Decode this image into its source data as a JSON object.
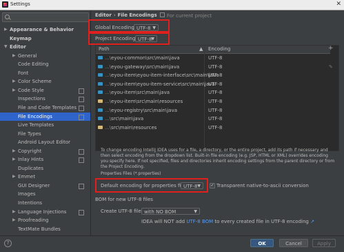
{
  "window": {
    "title": "Settings"
  },
  "sidebar": {
    "items": [
      {
        "label": "Appearance & Behavior",
        "arrow": "▶",
        "indent": 0,
        "bold": true
      },
      {
        "label": "Keymap",
        "arrow": "",
        "indent": 0,
        "bold": true
      },
      {
        "label": "Editor",
        "arrow": "▼",
        "indent": 0,
        "bold": true
      },
      {
        "label": "General",
        "arrow": "▶",
        "indent": 1
      },
      {
        "label": "Code Editing",
        "arrow": "",
        "indent": 1
      },
      {
        "label": "Font",
        "arrow": "",
        "indent": 1
      },
      {
        "label": "Color Scheme",
        "arrow": "▶",
        "indent": 1
      },
      {
        "label": "Code Style",
        "arrow": "▶",
        "indent": 1,
        "project": true
      },
      {
        "label": "Inspections",
        "arrow": "",
        "indent": 1,
        "project": true
      },
      {
        "label": "File and Code Templates",
        "arrow": "",
        "indent": 1,
        "project": true
      },
      {
        "label": "File Encodings",
        "arrow": "",
        "indent": 1,
        "project": true,
        "selected": true
      },
      {
        "label": "Live Templates",
        "arrow": "",
        "indent": 1
      },
      {
        "label": "File Types",
        "arrow": "",
        "indent": 1
      },
      {
        "label": "Android Layout Editor",
        "arrow": "",
        "indent": 1
      },
      {
        "label": "Copyright",
        "arrow": "▶",
        "indent": 1,
        "project": true
      },
      {
        "label": "Inlay Hints",
        "arrow": "▶",
        "indent": 1,
        "project": true
      },
      {
        "label": "Duplicates",
        "arrow": "",
        "indent": 1
      },
      {
        "label": "Emmet",
        "arrow": "▶",
        "indent": 1
      },
      {
        "label": "GUI Designer",
        "arrow": "",
        "indent": 1,
        "project": true
      },
      {
        "label": "Images",
        "arrow": "",
        "indent": 1
      },
      {
        "label": "Intentions",
        "arrow": "",
        "indent": 1
      },
      {
        "label": "Language Injections",
        "arrow": "▶",
        "indent": 1,
        "project": true
      },
      {
        "label": "Proofreading",
        "arrow": "▶",
        "indent": 1
      },
      {
        "label": "TextMate Bundles",
        "arrow": "",
        "indent": 1
      }
    ]
  },
  "breadcrumb": {
    "parent": "Editor",
    "separator": "›",
    "current": "File Encodings",
    "note": "For current project"
  },
  "global_encoding": {
    "label": "Global Encoding:",
    "value": "UTF-8"
  },
  "project_encoding": {
    "label": "Project Encoding:",
    "value": "UTF-8"
  },
  "table": {
    "headers": {
      "path": "Path",
      "sort": "▲",
      "encoding": "Encoding"
    },
    "rows": [
      {
        "dim": "...\\",
        "path": "eyou-common\\src\\main\\java",
        "encoding": "UTF-8",
        "folder": "blue"
      },
      {
        "dim": "...\\",
        "path": "eyou-gateway\\src\\main\\java",
        "encoding": "UTF-8",
        "folder": "blue"
      },
      {
        "dim": "...\\",
        "path": "eyou-item\\eyou-item-interface\\src\\main\\java",
        "encoding": "UTF-8",
        "folder": "blue"
      },
      {
        "dim": "...\\",
        "path": "eyou-item\\eyou-item-service\\src\\main\\java",
        "encoding": "UTF-8",
        "folder": "blue"
      },
      {
        "dim": "...\\",
        "path": "eyou-item\\src\\main\\java",
        "encoding": "UTF-8",
        "folder": "blue"
      },
      {
        "dim": "...\\",
        "path": "eyou-item\\src\\main\\resources",
        "encoding": "UTF-8",
        "folder": "tan"
      },
      {
        "dim": "...\\",
        "path": "eyou-registry\\src\\main\\java",
        "encoding": "UTF-8",
        "folder": "blue"
      },
      {
        "dim": "...\\",
        "path": "src\\main\\java",
        "encoding": "UTF-8",
        "folder": "blue"
      },
      {
        "dim": "...\\",
        "path": "src\\main\\resources",
        "encoding": "UTF-8",
        "folder": "tan"
      }
    ]
  },
  "description": "To change encoding IntelliJ IDEA uses for a file, a directory, or the entire project, add its path if necessary and then select encoding from the dropdown list. Built-in file encoding (e.g. JSP, HTML or XML) overrides encoding you specify here. If not specified, files and directories inherit encoding settings from the parent directory or from the Project Encoding.",
  "properties": {
    "section": "Properties Files (*.properties)",
    "default_label": "Default encoding for properties files:",
    "default_value": "UTF-8",
    "native_label": "Transparent native-to-ascii conversion",
    "native_checked": "✓"
  },
  "bom": {
    "section": "BOM for new UTF-8 files",
    "create_label": "Create UTF-8 files:",
    "create_value": "with NO BOM",
    "note_prefix": "IDEA will NOT add",
    "note_link": "UTF-8 BOM",
    "note_suffix": "to every created file in UTF-8 encoding",
    "note_arrow": "↗"
  },
  "buttons": {
    "ok": "OK",
    "cancel": "Cancel",
    "apply": "Apply",
    "help": "?"
  },
  "colors": {
    "accent": "#2f65ca",
    "highlight": "#e0201c",
    "background": "#3c3f41"
  }
}
